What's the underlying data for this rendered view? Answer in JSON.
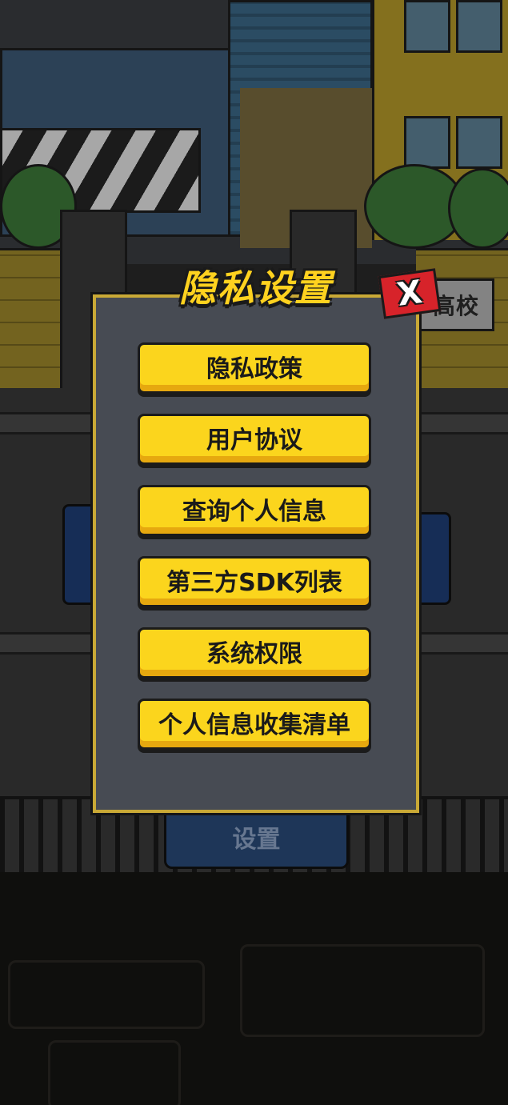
{
  "dialog": {
    "title": "隐私设置",
    "close_label": "X",
    "buttons": [
      {
        "label": "隐私政策"
      },
      {
        "label": "用户协议"
      },
      {
        "label": "查询个人信息"
      },
      {
        "label": "第三方SDK列表"
      },
      {
        "label": "系统权限"
      },
      {
        "label": "个人信息收集清单"
      }
    ]
  },
  "background": {
    "sign_text": "高校",
    "settings_button_label": "设置"
  },
  "colors": {
    "button_yellow": "#fbd51d",
    "panel_gray": "#474b53",
    "panel_border": "#c9a936",
    "close_red": "#d7232a",
    "title_yellow": "#ffd21f"
  }
}
